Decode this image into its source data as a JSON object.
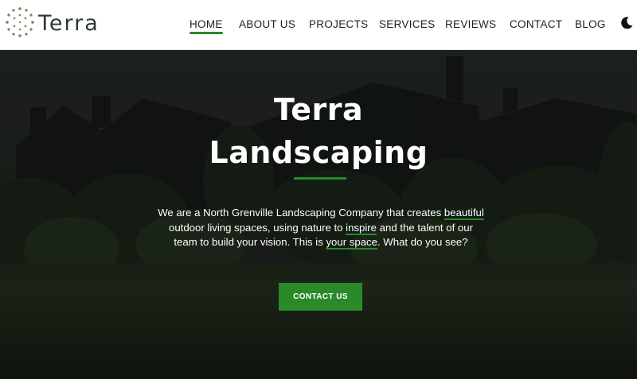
{
  "brand": {
    "name": "Terra"
  },
  "nav": {
    "items": [
      {
        "label": "HOME",
        "active": true
      },
      {
        "label": "ABOUT US"
      },
      {
        "label": "PROJECTS"
      },
      {
        "label": "SERVICES"
      },
      {
        "label": "REVIEWS"
      },
      {
        "label": "CONTACT"
      },
      {
        "label": "BLOG"
      }
    ],
    "theme_toggle_icon": "moon-icon"
  },
  "hero": {
    "title_line1": "Terra",
    "title_line2": "Landscaping",
    "text": {
      "p1": "We are a North Grenville Landscaping Company that creates",
      "hl1": "beautiful",
      "p2": " outdoor living spaces, using nature to ",
      "hl2": "inspire",
      "p3": " and the talent of our team to build your vision. This is ",
      "hl3": "your space",
      "p4": ". What do you see?"
    },
    "cta_label": "CONTACT US"
  },
  "colors": {
    "accent": "#2a8a2a",
    "header_bg": "#ffffff",
    "hero_text": "#ffffff"
  }
}
